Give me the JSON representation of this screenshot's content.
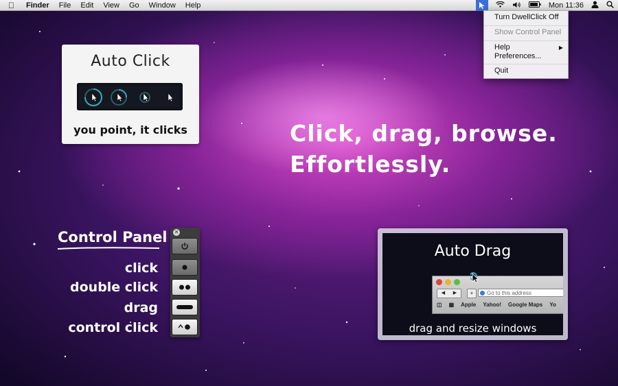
{
  "menubar": {
    "menus": [
      "Finder",
      "File",
      "Edit",
      "View",
      "Go",
      "Window",
      "Help"
    ],
    "clock": "Mon 11:36",
    "icons": [
      "apple-icon",
      "dwellclick-icon",
      "wifi-icon",
      "volume-icon",
      "battery-icon",
      "user-icon",
      "spotlight-icon"
    ]
  },
  "dropdown": {
    "turn_off": "Turn DwellClick Off",
    "show_panel": "Show Control Panel",
    "help": "Help",
    "preferences": "Preferences...",
    "quit": "Quit"
  },
  "auto_click": {
    "title": "Auto Click",
    "caption": "you point, it clicks"
  },
  "headline": {
    "line1": "Click, drag, browse.",
    "line2": "Effortlessly."
  },
  "control_panel": {
    "title": "Control Panel",
    "labels": [
      "click",
      "double click",
      "drag",
      "control click"
    ]
  },
  "auto_drag": {
    "title": "Auto Drag",
    "caption": "drag and resize windows",
    "browser": {
      "address_placeholder": "Go to this address",
      "bookmarks": [
        "Apple",
        "Yahoo!",
        "Google Maps",
        "Yo"
      ]
    }
  },
  "colors": {
    "accent": "#3a6fd8",
    "wallpaper_core": "#d94cc8",
    "wallpaper_edge": "#14082a"
  }
}
